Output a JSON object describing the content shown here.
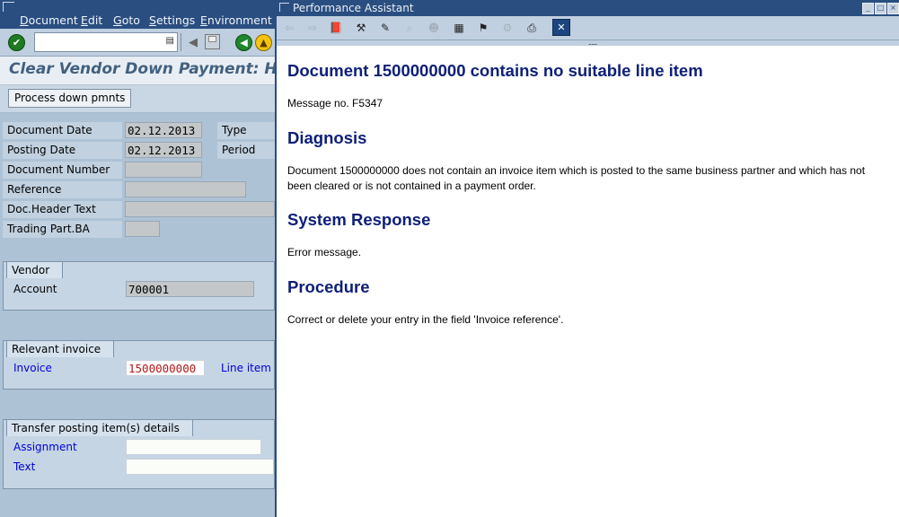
{
  "sap": {
    "menu": [
      "Document",
      "Edit",
      "Goto",
      "Settings",
      "Environment"
    ],
    "command_field_value": "",
    "screen_title": "Clear Vendor Down Payment: Header Data",
    "process_button": "Process down pmnts",
    "header_fields": [
      {
        "label": "Document Date",
        "value": "02.12.2013",
        "side_label": "Type"
      },
      {
        "label": "Posting Date",
        "value": "02.12.2013",
        "side_label": "Period"
      },
      {
        "label": "Document Number",
        "value": ""
      },
      {
        "label": "Reference",
        "value": ""
      },
      {
        "label": "Doc.Header Text",
        "value": ""
      },
      {
        "label": "Trading Part.BA",
        "value": ""
      }
    ],
    "vendor_group": {
      "title": "Vendor",
      "account_label": "Account",
      "account_value": "700001"
    },
    "invoice_group": {
      "title": "Relevant invoice",
      "invoice_label": "Invoice",
      "invoice_value": "1500000000",
      "line_item_label": "Line item"
    },
    "transfer_group": {
      "title": "Transfer posting item(s) details",
      "assignment_label": "Assignment",
      "assignment_value": "",
      "text_label": "Text",
      "text_value": ""
    }
  },
  "assistant": {
    "window_title": "Performance Assistant",
    "heading": "Document 1500000000 contains no suitable line item",
    "message_no": "Message no. F5347",
    "diagnosis_title": "Diagnosis",
    "diagnosis_text": "Document 1500000000 does not contain an invoice item which is posted to the same business partner and which has not been cleared or is not contained in a payment order.",
    "system_response_title": "System Response",
    "system_response_text": "Error message.",
    "procedure_title": "Procedure",
    "procedure_text": "Correct or delete your entry in the field 'Invoice reference'."
  }
}
